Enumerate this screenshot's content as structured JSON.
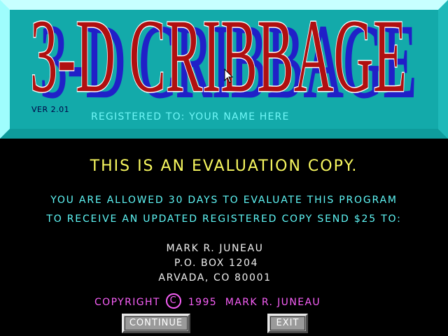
{
  "title": {
    "text": "3-D CRIBBAGE",
    "front_color": "#b01010",
    "shadow_color": "#2020c8",
    "outline_color": "#ffffff"
  },
  "version": "VER 2.01",
  "registration": "REGISTERED TO: YOUR NAME HERE",
  "evaluation_notice": "THIS IS AN EVALUATION COPY.",
  "messages": [
    "YOU ARE ALLOWED 30 DAYS TO EVALUATE THIS PROGRAM",
    "TO RECEIVE AN UPDATED REGISTERED COPY SEND $25 TO:"
  ],
  "address": {
    "name": "MARK R. JUNEAU",
    "po_box": "P.O. BOX 1204",
    "city": "ARVADA,  CO 80001"
  },
  "copyright": {
    "label": "COPYRIGHT",
    "symbol": "C",
    "text": "1995  MARK R. JUNEAU"
  },
  "buttons": {
    "continue": "CONTINUE",
    "exit": "EXIT"
  },
  "icons": {
    "cursor": "arrow-pointer-icon",
    "copyright": "copyright-icon"
  },
  "colors": {
    "banner_face": "#13aaaa",
    "eval_notice": "#f7f75f",
    "messages": "#5ff7f7",
    "address": "#f0f0f0",
    "copyright": "#f75ff7",
    "button_face": "#9a9a9a"
  }
}
